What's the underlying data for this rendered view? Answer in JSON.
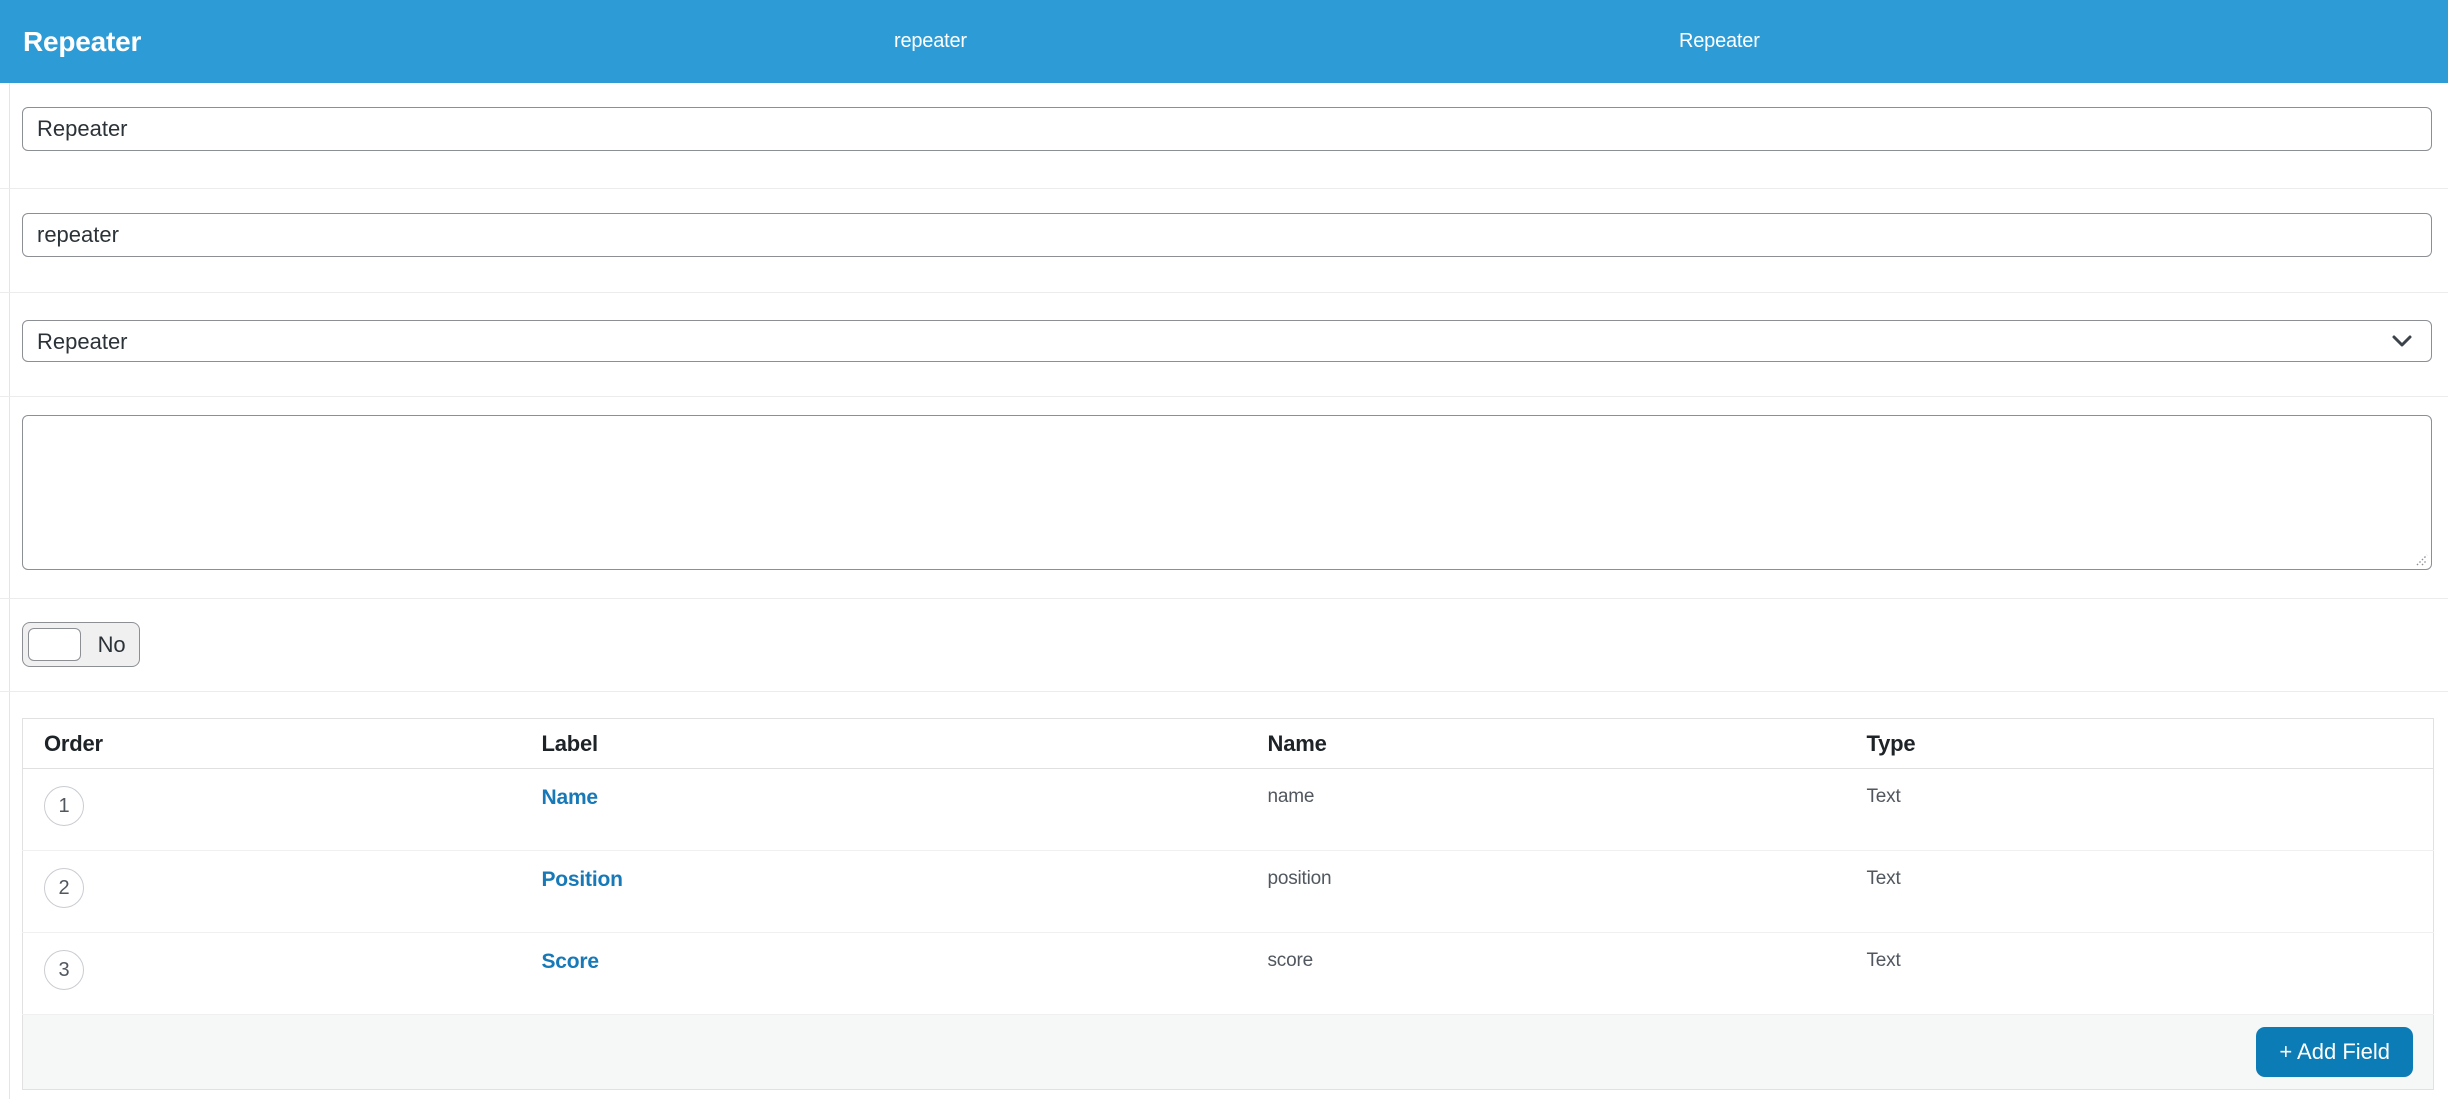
{
  "header": {
    "title": "Repeater",
    "name": "repeater",
    "type": "Repeater"
  },
  "form": {
    "label_input": {
      "value": "Repeater"
    },
    "name_input": {
      "value": "repeater"
    },
    "type_select": {
      "selected": "Repeater"
    },
    "description_textarea": {
      "value": ""
    },
    "toggle": {
      "state": "No"
    }
  },
  "fields_table": {
    "columns": {
      "order": "Order",
      "label": "Label",
      "name": "Name",
      "type": "Type"
    },
    "rows": [
      {
        "order": "1",
        "label": "Name",
        "name": "name",
        "type": "Text"
      },
      {
        "order": "2",
        "label": "Position",
        "name": "position",
        "type": "Text"
      },
      {
        "order": "3",
        "label": "Score",
        "name": "score",
        "type": "Text"
      }
    ],
    "add_button_label": "+ Add Field"
  },
  "colors": {
    "header_bg": "#2d9bd6",
    "link_blue": "#1779b8",
    "button_bg": "#0b7cb5",
    "input_border": "#8c8f94",
    "footer_bg": "#f6f7f7"
  }
}
